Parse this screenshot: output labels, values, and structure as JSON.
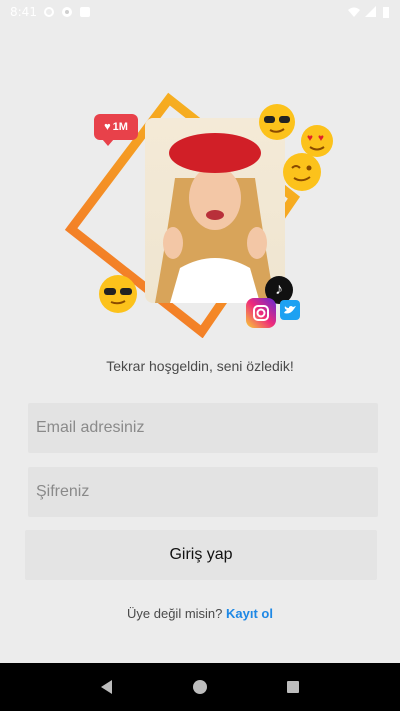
{
  "status_bar": {
    "time": "8:41"
  },
  "hero": {
    "badge_likes": "1M"
  },
  "welcome_text": "Tekrar hoşgeldin, seni özledik!",
  "login_form": {
    "email_placeholder": "Email adresiniz",
    "password_placeholder": "Şifreniz",
    "submit_label": "Giriş yap"
  },
  "signup": {
    "prompt": "Üye değil misin?",
    "link_label": "Kayıt ol"
  },
  "colors": {
    "accent": "#1e88e5",
    "frame_gradient_start": "#f26b2b",
    "frame_gradient_end": "#f7c21c"
  }
}
